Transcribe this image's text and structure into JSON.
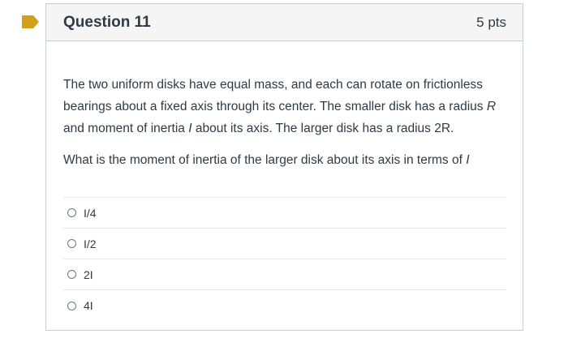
{
  "question": {
    "title": "Question 11",
    "points": "5 pts",
    "flag_color": "#d4a017",
    "paragraph1_parts": [
      "The two uniform disks have equal mass, and each can rotate on frictionless bearings about a fixed axis through its center. The smaller disk has a radius ",
      "R",
      " and moment of inertia ",
      "I",
      " about its axis. The larger disk has a radius 2R."
    ],
    "paragraph2_parts": [
      "What is the moment of inertia of the larger disk about its axis in terms of ",
      "I"
    ]
  },
  "answers": [
    {
      "label": "I/4"
    },
    {
      "label": "I/2"
    },
    {
      "label": "2I"
    },
    {
      "label": "4I"
    }
  ]
}
